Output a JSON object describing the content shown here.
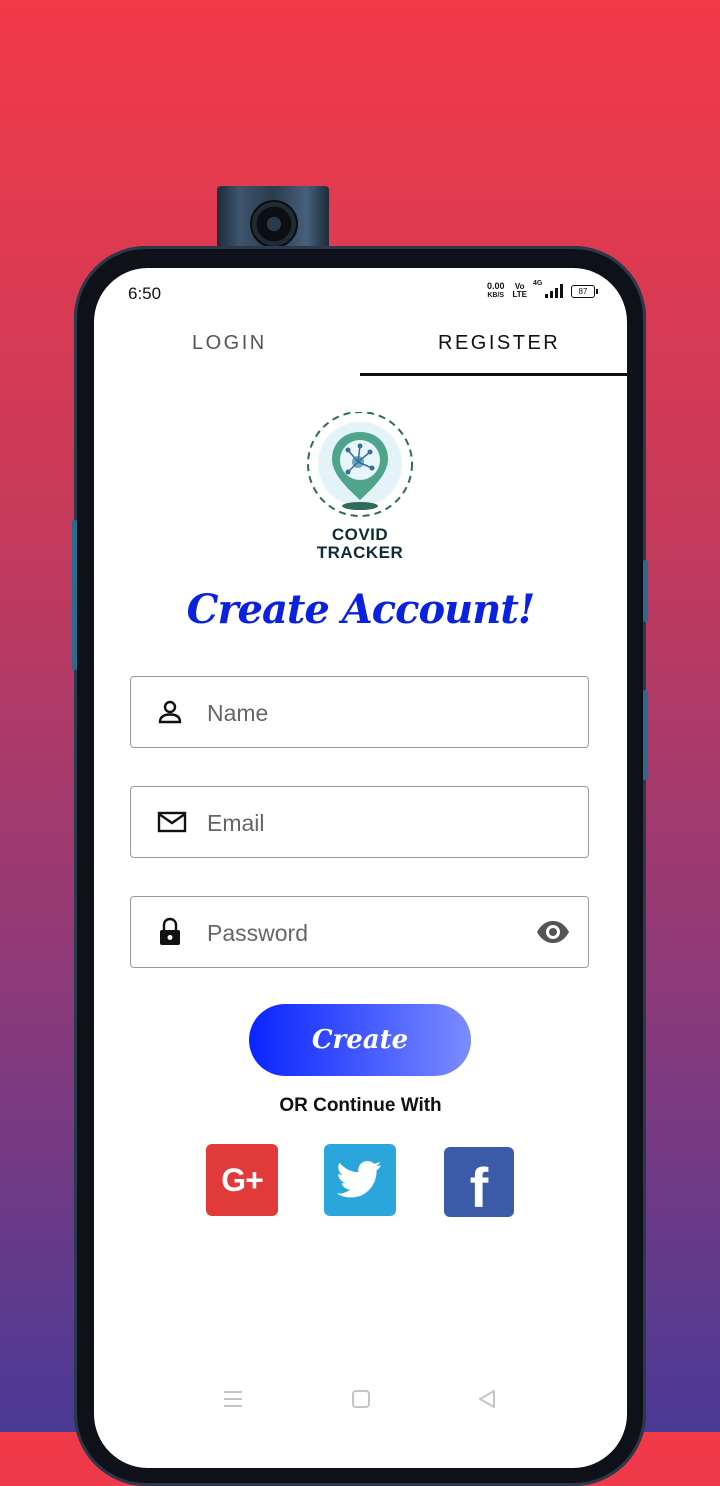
{
  "status_bar": {
    "time": "6:50",
    "net_speed_value": "0.00",
    "net_speed_unit": "KB/S",
    "volte_top": "Vo",
    "volte_bottom": "LTE",
    "network": "4G",
    "battery": "87"
  },
  "tabs": [
    {
      "label": "LOGIN",
      "active": false
    },
    {
      "label": "REGISTER",
      "active": true
    }
  ],
  "logo": {
    "line1": "COVID",
    "line2": "TRACKER"
  },
  "headline": "Create Account!",
  "form": {
    "name": {
      "placeholder": "Name",
      "icon": "person-icon"
    },
    "email": {
      "placeholder": "Email",
      "icon": "mail-icon"
    },
    "password": {
      "placeholder": "Password",
      "icon": "lock-icon",
      "toggle_icon": "eye-icon"
    }
  },
  "create_button": "Create",
  "or_text": "OR Continue With",
  "social": [
    {
      "name": "google-plus",
      "label": "G+",
      "color": "#e03a3a"
    },
    {
      "name": "twitter",
      "color": "#2ba6dc"
    },
    {
      "name": "facebook",
      "label": "f",
      "color": "#3b5aa8"
    }
  ],
  "nav_icons": [
    "menu-icon",
    "home-square-icon",
    "back-triangle-icon"
  ],
  "colors": {
    "accent": "#0a22e0",
    "background_top": "#f23a48",
    "background_bottom": "#4a3a96"
  }
}
